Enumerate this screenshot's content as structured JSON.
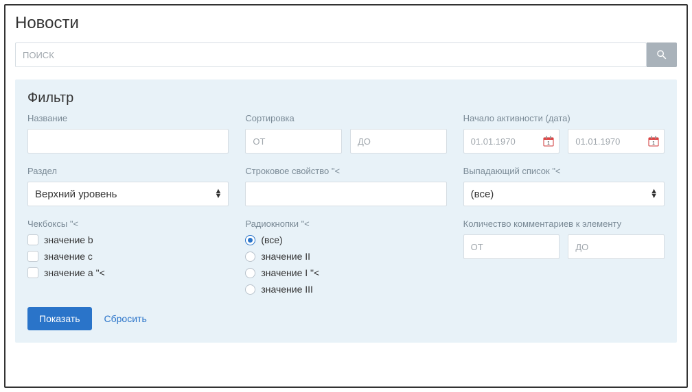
{
  "page": {
    "title": "Новости"
  },
  "search": {
    "placeholder": "Поиск"
  },
  "filter": {
    "title": "Фильтр",
    "name_label": "Название",
    "sort_label": "Сортировка",
    "sort_from_ph": "от",
    "sort_to_ph": "до",
    "active_date_label": "Начало активности (дата)",
    "date_ph": "01.01.1970",
    "section_label": "Раздел",
    "section_value": "Верхний уровень",
    "string_prop_label": "Строковое свойство \"<",
    "dropdown_label": "Выпадающий список \"<",
    "dropdown_value": "(все)",
    "checkboxes_label": "Чекбоксы \"<",
    "checkboxes": [
      {
        "label": "значение b"
      },
      {
        "label": "значение c"
      },
      {
        "label": "значение a \"<"
      }
    ],
    "radios_label": "Радиокнопки \"<",
    "radios": [
      {
        "label": "(все)",
        "checked": true
      },
      {
        "label": "значение II",
        "checked": false
      },
      {
        "label": "значение I \"<",
        "checked": false
      },
      {
        "label": "значение III",
        "checked": false
      }
    ],
    "comments_label": "Количество комментариев к элементу",
    "comments_from_ph": "от",
    "comments_to_ph": "до",
    "submit_label": "Показать",
    "reset_label": "Сбросить"
  }
}
